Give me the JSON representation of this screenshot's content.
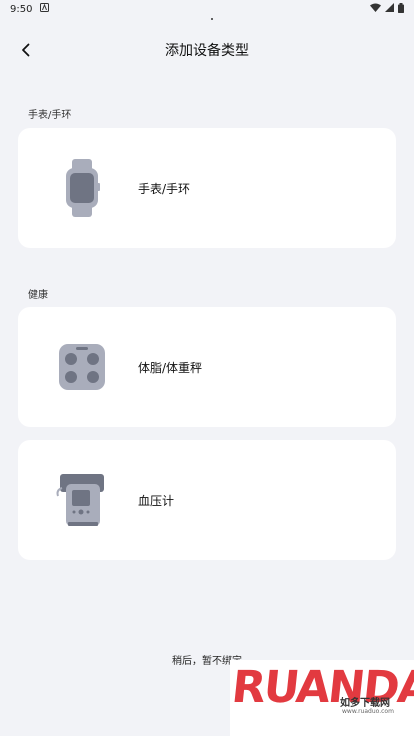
{
  "status_bar": {
    "time": "9:50",
    "icons": [
      "notification-a-icon",
      "wifi-icon",
      "signal-icon",
      "battery-icon"
    ]
  },
  "header": {
    "title": "添加设备类型",
    "back_icon": "chevron-left-icon"
  },
  "sections": [
    {
      "label": "手表/手环",
      "items": [
        {
          "label": "手表/手环",
          "icon": "smartwatch-icon"
        }
      ]
    },
    {
      "label": "健康",
      "items": [
        {
          "label": "体脂/体重秤",
          "icon": "body-fat-scale-icon"
        },
        {
          "label": "血压计",
          "icon": "blood-pressure-monitor-icon"
        }
      ]
    }
  ],
  "footer": {
    "skip_text": "稍后，暂不绑定"
  },
  "watermark": {
    "logo": "RUANDADO",
    "subtitle": "如多下载网",
    "url": "www.ruaduo.com"
  },
  "colors": {
    "background": "#f2f3f7",
    "card": "#ffffff",
    "icon_gray": "#a9adbb",
    "watermark_red": "#e23a40"
  }
}
